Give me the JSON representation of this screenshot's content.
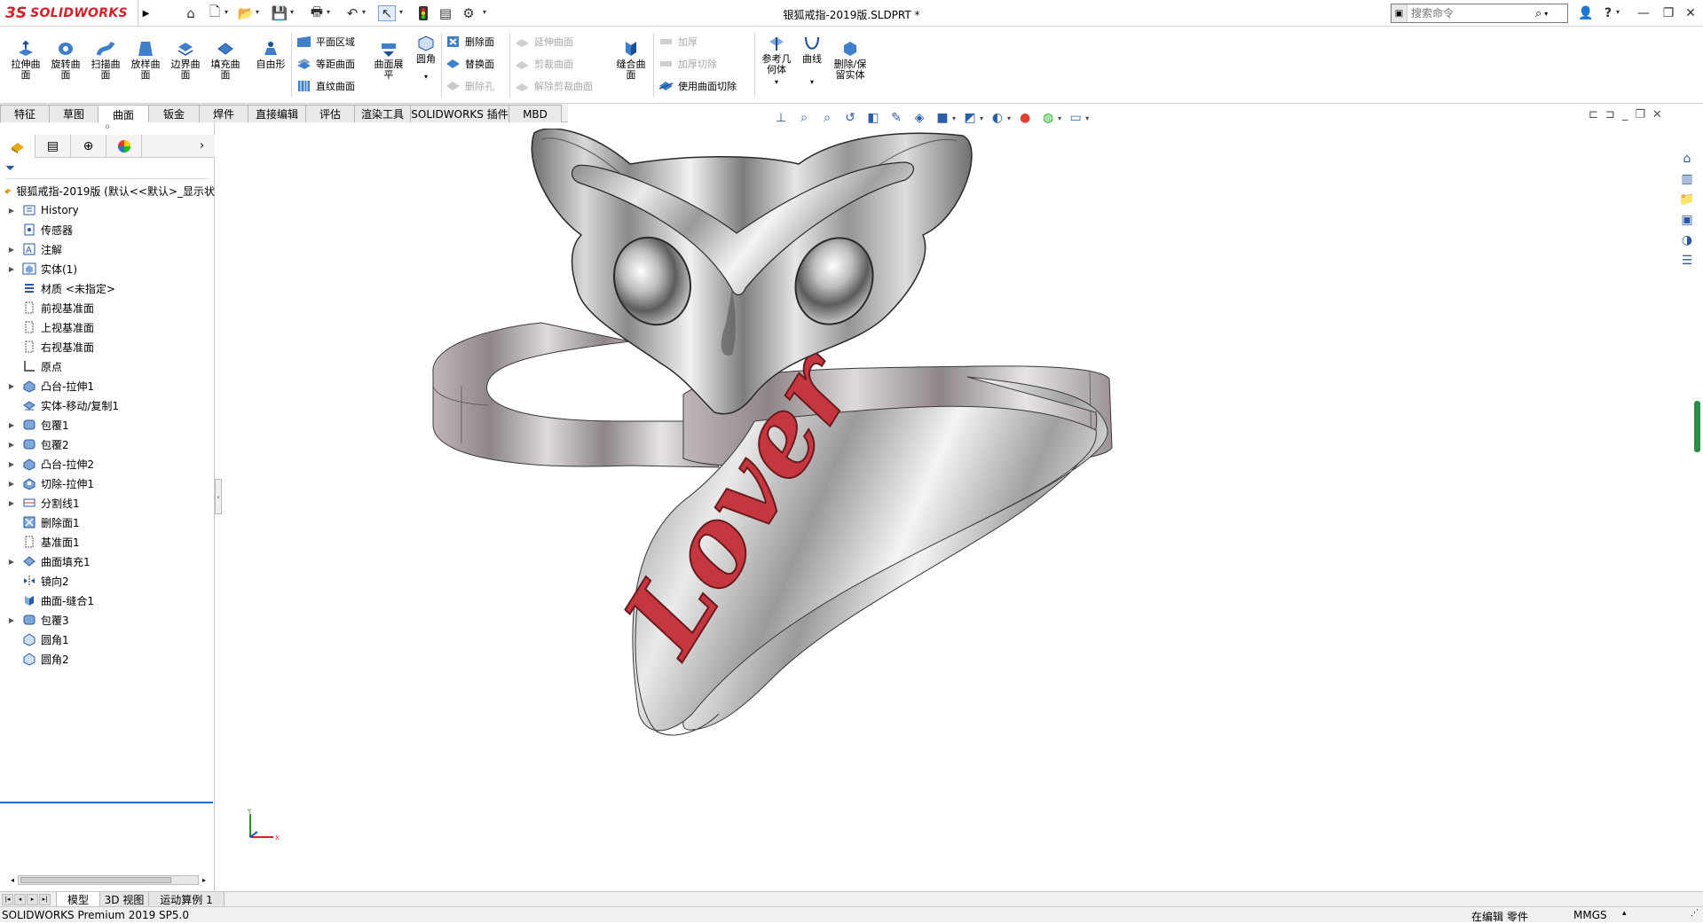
{
  "app": {
    "logo_text": "SOLIDWORKS",
    "document_title": "银狐戒指-2019版.SLDPRT *",
    "search_placeholder": "搜索命令"
  },
  "ribbon": {
    "big_buttons": [
      {
        "label": "拉伸曲\n面",
        "icon": "extrude-surface-icon"
      },
      {
        "label": "旋转曲\n面",
        "icon": "revolve-surface-icon"
      },
      {
        "label": "扫描曲\n面",
        "icon": "sweep-surface-icon"
      },
      {
        "label": "放样曲\n面",
        "icon": "loft-surface-icon"
      },
      {
        "label": "边界曲\n面",
        "icon": "boundary-surface-icon"
      },
      {
        "label": "填充曲\n面",
        "icon": "fill-surface-icon"
      },
      {
        "label": "自由形",
        "icon": "freeform-icon"
      }
    ],
    "group2_small": [
      "平面区域",
      "等距曲面",
      "直纹曲面"
    ],
    "surface_flatten": "曲面展\n平",
    "fillet": "圆角",
    "group3_small": [
      "删除面",
      "替换面",
      "删除孔"
    ],
    "group4_small_disabled": [
      "延伸曲面",
      "剪裁曲面",
      "解除剪裁曲面"
    ],
    "knit_surface": "缝合曲\n面",
    "group5_small": [
      "加厚",
      "加厚切除",
      "使用曲面切除"
    ],
    "ref_geometry": "参考几\n何体",
    "curves": "曲线",
    "delete_keep_body": "删除/保\n留实体"
  },
  "tabs": [
    "特征",
    "草图",
    "曲面",
    "钣金",
    "焊件",
    "直接编辑",
    "评估",
    "渲染工具",
    "SOLIDWORKS 插件",
    "MBD"
  ],
  "active_tab": "曲面",
  "feature_tree": {
    "root": "银狐戒指-2019版 (默认<<默认>_显示状",
    "items": [
      {
        "label": "History",
        "expand": true,
        "icon": "history-icon"
      },
      {
        "label": "传感器",
        "expand": false,
        "icon": "sensor-icon"
      },
      {
        "label": "注解",
        "expand": true,
        "icon": "annotation-icon"
      },
      {
        "label": "实体(1)",
        "expand": true,
        "icon": "solid-body-icon"
      },
      {
        "label": "材质 <未指定>",
        "expand": false,
        "icon": "material-icon"
      },
      {
        "label": "前视基准面",
        "expand": false,
        "icon": "plane-icon"
      },
      {
        "label": "上视基准面",
        "expand": false,
        "icon": "plane-icon"
      },
      {
        "label": "右视基准面",
        "expand": false,
        "icon": "plane-icon"
      },
      {
        "label": "原点",
        "expand": false,
        "icon": "origin-icon"
      },
      {
        "label": "凸台-拉伸1",
        "expand": true,
        "icon": "boss-extrude-icon"
      },
      {
        "label": "实体-移动/复制1",
        "expand": false,
        "icon": "move-copy-icon"
      },
      {
        "label": "包覆1",
        "expand": true,
        "icon": "wrap-icon"
      },
      {
        "label": "包覆2",
        "expand": true,
        "icon": "wrap-icon"
      },
      {
        "label": "凸台-拉伸2",
        "expand": true,
        "icon": "boss-extrude-icon"
      },
      {
        "label": "切除-拉伸1",
        "expand": true,
        "icon": "cut-extrude-icon"
      },
      {
        "label": "分割线1",
        "expand": true,
        "icon": "split-line-icon"
      },
      {
        "label": "删除面1",
        "expand": false,
        "icon": "delete-face-icon"
      },
      {
        "label": "基准面1",
        "expand": false,
        "icon": "plane-icon"
      },
      {
        "label": "曲面填充1",
        "expand": true,
        "icon": "fill-surface-icon"
      },
      {
        "label": "镜向2",
        "expand": false,
        "icon": "mirror-icon"
      },
      {
        "label": "曲面-缝合1",
        "expand": false,
        "icon": "knit-icon"
      },
      {
        "label": "包覆3",
        "expand": true,
        "icon": "wrap-icon"
      },
      {
        "label": "圆角1",
        "expand": false,
        "icon": "fillet-icon"
      },
      {
        "label": "圆角2",
        "expand": false,
        "icon": "fillet-icon"
      }
    ]
  },
  "bottom_tabs": [
    "模型",
    "3D 视图",
    "运动算例 1"
  ],
  "status": {
    "product": "SOLIDWORKS Premium 2019 SP5.0",
    "editing": "在编辑 零件",
    "units": "MMGS"
  },
  "model": {
    "engraving_text": "Lover",
    "metal_color": "#9a9a9a",
    "engraving_color": "#c4373f"
  }
}
